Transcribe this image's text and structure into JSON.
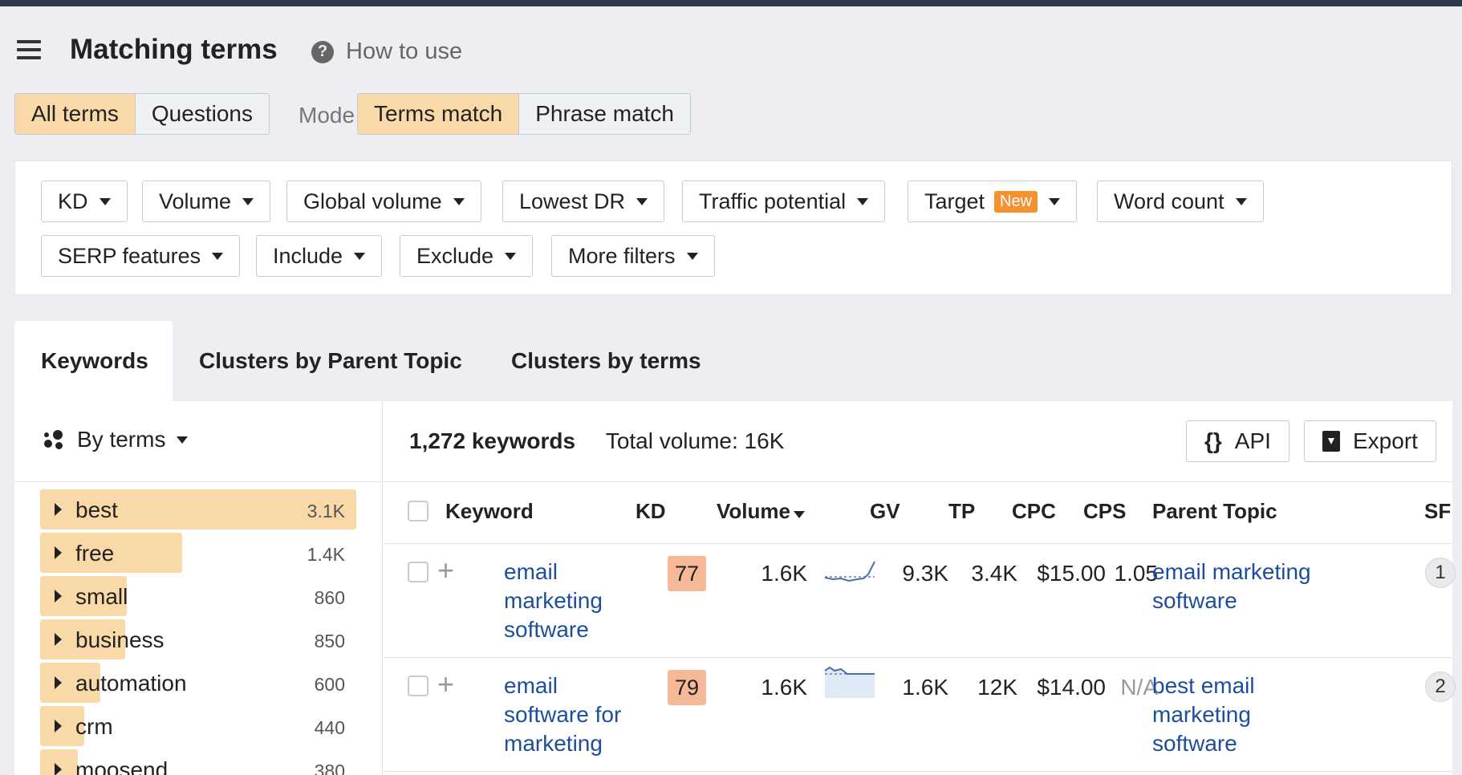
{
  "header": {
    "title": "Matching terms",
    "help_label": "How to use"
  },
  "scope_tabs": [
    {
      "label": "All terms",
      "active": true
    },
    {
      "label": "Questions",
      "active": false
    }
  ],
  "mode": {
    "label": "Mode",
    "options": [
      {
        "label": "Terms match",
        "active": true
      },
      {
        "label": "Phrase match",
        "active": false
      }
    ]
  },
  "filters": {
    "row1": [
      "KD",
      "Volume",
      "Global volume",
      "Lowest DR",
      "Traffic potential",
      "Target",
      "Word count"
    ],
    "target_badge": "New",
    "row2": [
      "SERP features",
      "Include",
      "Exclude",
      "More filters"
    ]
  },
  "tabs": [
    "Keywords",
    "Clusters by Parent Topic",
    "Clusters by terms"
  ],
  "left_panel": {
    "group_by_label": "By terms",
    "terms": [
      {
        "label": "best",
        "count": "3.1K",
        "fraction": 1.0
      },
      {
        "label": "free",
        "count": "1.4K",
        "fraction": 0.45
      },
      {
        "label": "small",
        "count": "860",
        "fraction": 0.275
      },
      {
        "label": "business",
        "count": "850",
        "fraction": 0.27
      },
      {
        "label": "automation",
        "count": "600",
        "fraction": 0.19
      },
      {
        "label": "crm",
        "count": "440",
        "fraction": 0.14
      },
      {
        "label": "moosend",
        "count": "380",
        "fraction": 0.12
      }
    ]
  },
  "results": {
    "count": "1,272 keywords",
    "total_volume": "Total volume: 16K",
    "api_label": "API",
    "export_label": "Export",
    "columns": [
      "Keyword",
      "KD",
      "Volume",
      "GV",
      "TP",
      "CPC",
      "CPS",
      "Parent Topic",
      "SF"
    ],
    "rows": [
      {
        "keyword_lines": [
          "email",
          "marketing",
          "software"
        ],
        "kd": "77",
        "volume": "1.6K",
        "gv": "9.3K",
        "tp": "3.4K",
        "cpc": "$15.00",
        "cps": "1.05",
        "parent_topic_lines": [
          "email marketing",
          "software"
        ],
        "sf": "1"
      },
      {
        "keyword_lines": [
          "email",
          "software for",
          "marketing"
        ],
        "kd": "79",
        "volume": "1.6K",
        "gv": "1.6K",
        "tp": "12K",
        "cpc": "$14.00",
        "cps": "N/A",
        "parent_topic_lines": [
          "best email",
          "marketing",
          "software"
        ],
        "sf": "2"
      }
    ]
  },
  "colors": {
    "accent_orange": "#fad9a8",
    "kd_hard": "#f5b997",
    "link_blue": "#1d4e9e",
    "new_badge": "#f5922f"
  }
}
